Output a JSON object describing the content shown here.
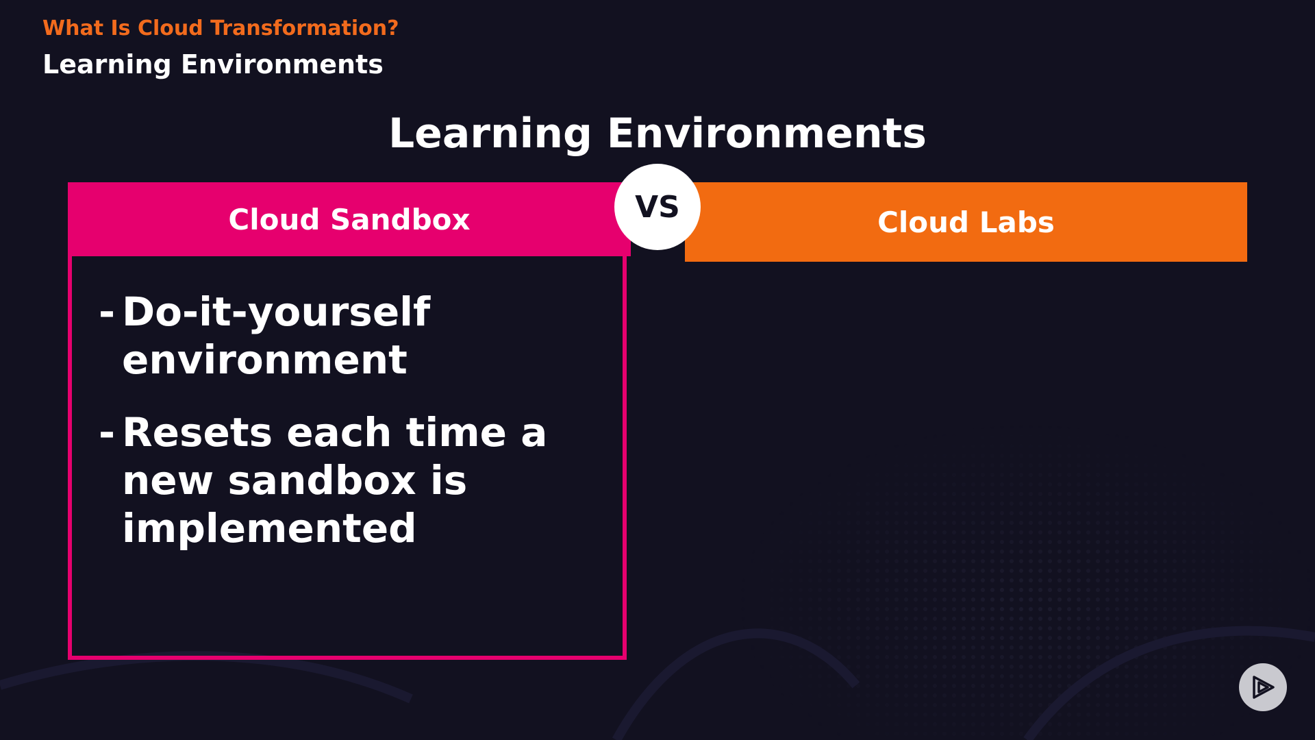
{
  "header": {
    "course_title": "What Is Cloud Transformation?",
    "module_title": "Learning Environments"
  },
  "slide": {
    "heading": "Learning Environments",
    "vs_label": "VS",
    "left_panel": {
      "title": "Cloud Sandbox",
      "color": "#e6006e",
      "bullets": [
        "Do-it-yourself environment",
        "Resets each time a new sandbox is implemented"
      ]
    },
    "right_panel": {
      "title": "Cloud Labs",
      "color": "#f26b11"
    }
  },
  "player": {
    "icon": "play-logo-icon"
  },
  "colors": {
    "background": "#121120",
    "accent_orange": "#f26b1d",
    "text": "#ffffff"
  }
}
